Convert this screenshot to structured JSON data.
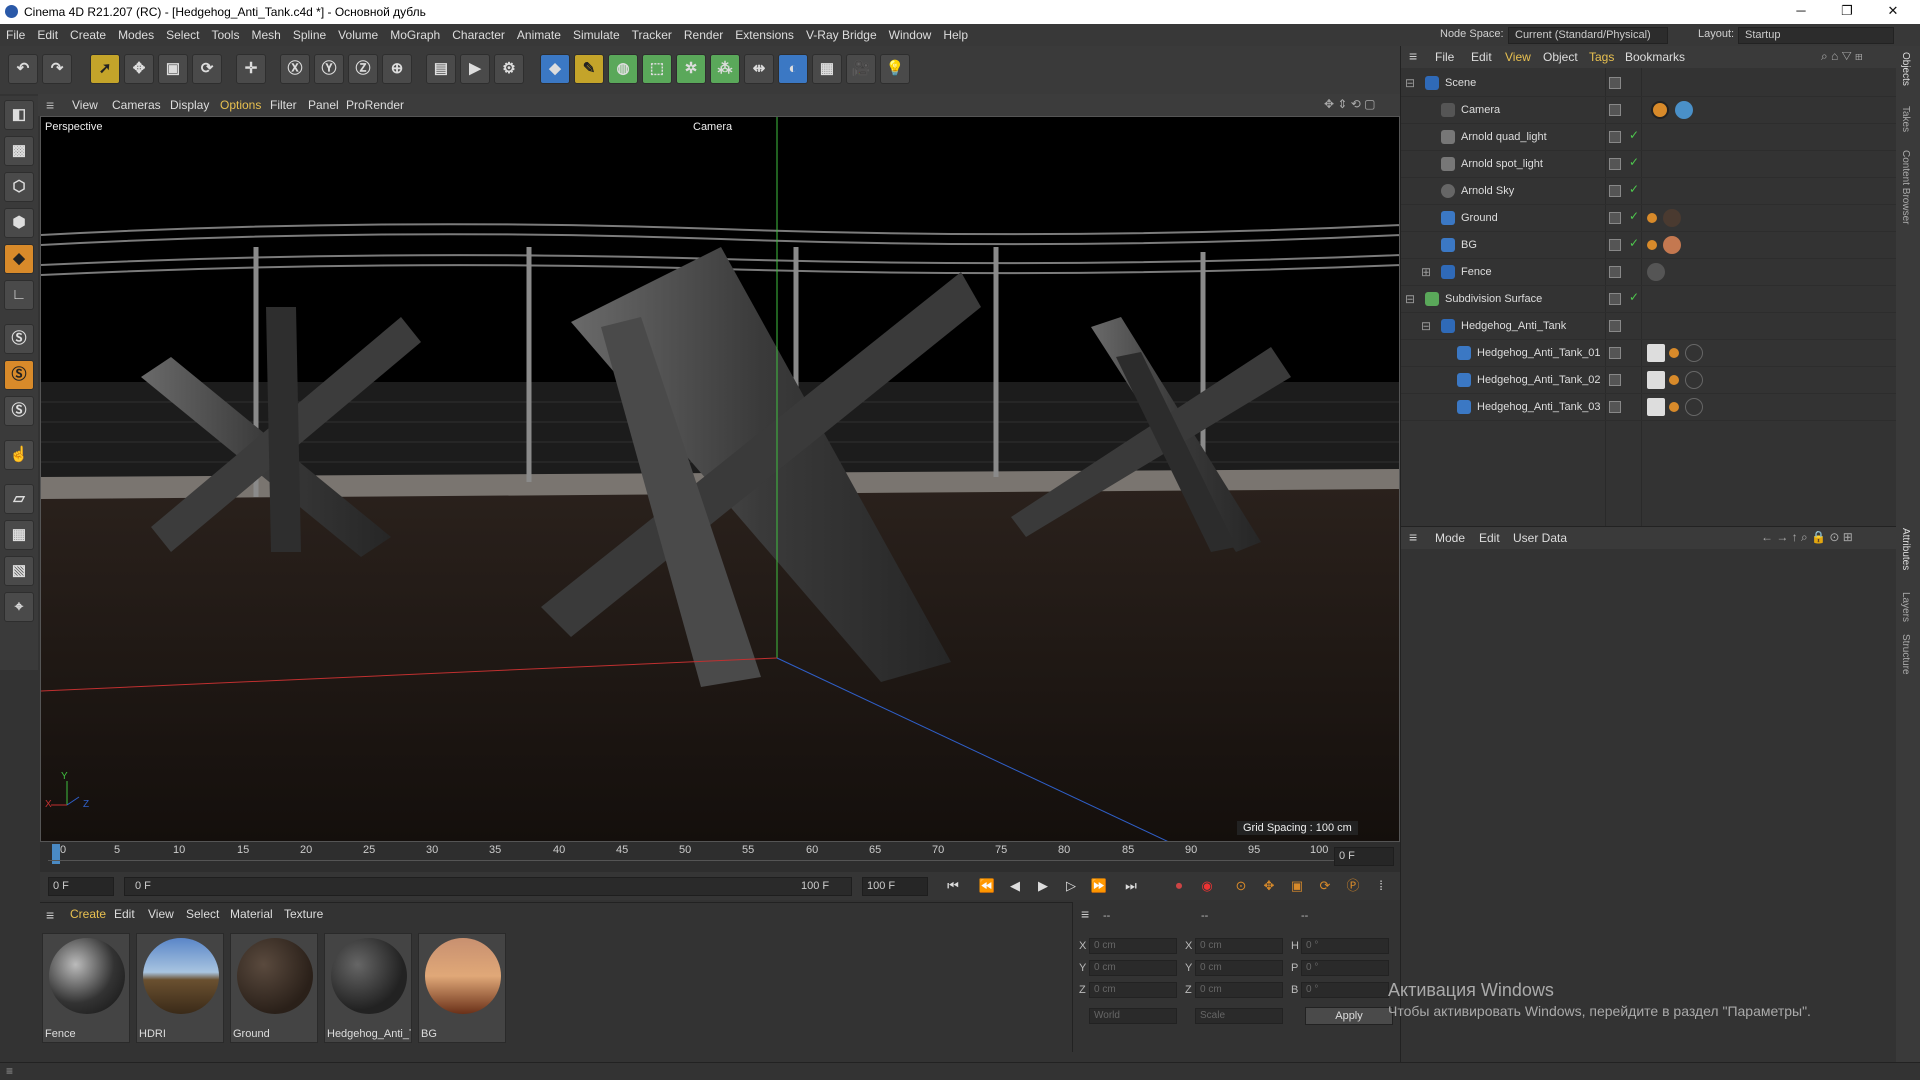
{
  "window": {
    "title": "Cinema 4D R21.207 (RC) - [Hedgehog_Anti_Tank.c4d *] - Основной дубль",
    "minimize": "─",
    "maximize": "❐",
    "close": "✕"
  },
  "menu": [
    "File",
    "Edit",
    "Create",
    "Modes",
    "Select",
    "Tools",
    "Mesh",
    "Spline",
    "Volume",
    "MoGraph",
    "Character",
    "Animate",
    "Simulate",
    "Tracker",
    "Render",
    "Extensions",
    "V-Ray Bridge",
    "Window",
    "Help"
  ],
  "nodespace": {
    "label": "Node Space:",
    "value": "Current (Standard/Physical)",
    "layout_label": "Layout:",
    "layout_value": "Startup"
  },
  "viewport_menu": [
    "View",
    "Cameras",
    "Display",
    "Options",
    "Filter",
    "Panel",
    "ProRender"
  ],
  "viewport": {
    "name": "Perspective",
    "camera": "Camera",
    "grid_spacing": "Grid Spacing : 100 cm",
    "axis_x": "X",
    "axis_y": "Y",
    "axis_z": "Z"
  },
  "timeline": {
    "ticks": [
      "0",
      "5",
      "10",
      "15",
      "20",
      "25",
      "30",
      "35",
      "40",
      "45",
      "50",
      "55",
      "60",
      "65",
      "70",
      "75",
      "80",
      "85",
      "90",
      "95",
      "100"
    ],
    "current": "0 F"
  },
  "transport": {
    "start": "0 F",
    "range_start": "0 F",
    "range_end": "100 F",
    "end": "100 F"
  },
  "material_menu": [
    "Create",
    "Edit",
    "View",
    "Select",
    "Material",
    "Texture"
  ],
  "materials": [
    "Fence",
    "HDRI",
    "Ground",
    "Hedgehog_Anti_T",
    "BG"
  ],
  "coords": {
    "header": [
      "--",
      "--",
      "--"
    ],
    "x": "X",
    "y": "Y",
    "z": "Z",
    "h": "H",
    "p": "P",
    "b": "B",
    "pos_x": "0 cm",
    "pos_y": "0 cm",
    "pos_z": "0 cm",
    "size_x": "0 cm",
    "size_y": "0 cm",
    "size_z": "0 cm",
    "rot_h": "0 °",
    "rot_p": "0 °",
    "rot_b": "0 °",
    "space": "World",
    "mode": "Scale",
    "apply": "Apply"
  },
  "object_menu": [
    "File",
    "Edit",
    "View",
    "Object",
    "Tags",
    "Bookmarks"
  ],
  "objects": [
    "Scene",
    "Camera",
    "Arnold quad_light",
    "Arnold spot_light",
    "Arnold Sky",
    "Ground",
    "BG",
    "Fence",
    "Subdivision Surface",
    "Hedgehog_Anti_Tank",
    "Hedgehog_Anti_Tank_01",
    "Hedgehog_Anti_Tank_02",
    "Hedgehog_Anti_Tank_03"
  ],
  "attr_menu": [
    "Mode",
    "Edit",
    "User Data"
  ],
  "side_tabs": [
    "Objects",
    "Takes",
    "Content Browser",
    "Attributes",
    "Layers",
    "Structure"
  ],
  "watermark": {
    "title": "Активация Windows",
    "text": "Чтобы активировать Windows, перейдите в раздел \"Параметры\"."
  },
  "colors": {
    "accent": "#c4a42a",
    "axis_green": "#3fbf3f",
    "axis_red": "#c03030",
    "axis_blue": "#2f5fc8"
  }
}
